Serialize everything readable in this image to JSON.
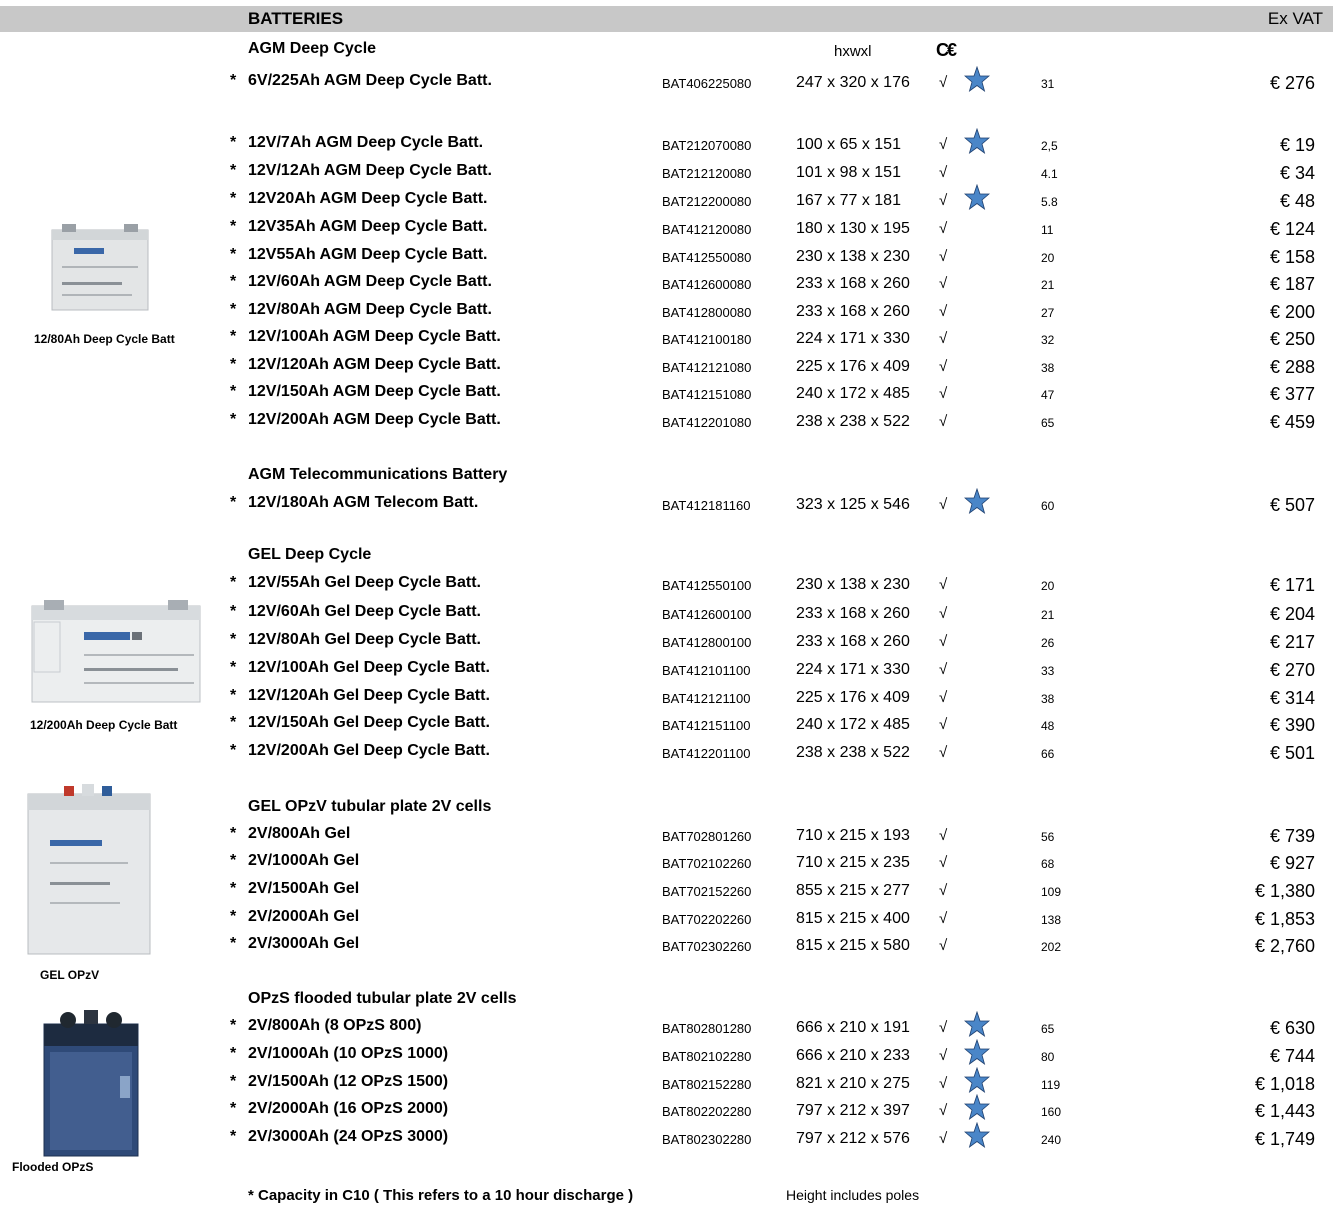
{
  "header": {
    "title": "BATTERIES",
    "exvat": "Ex VAT"
  },
  "columns": {
    "dims_label": "hxwxl",
    "ce_mark": "C€"
  },
  "sections": [
    {
      "title": "AGM Deep Cycle",
      "rows": [
        {
          "name": "6V/225Ah AGM Deep Cycle Batt.",
          "code": "BAT406225080",
          "dims": "247 x 320 x 176",
          "weight": "31",
          "price": "€ 276",
          "starred": true
        }
      ]
    },
    {
      "title": "",
      "rows": [
        {
          "name": "12V/7Ah AGM Deep Cycle Batt.",
          "code": "BAT212070080",
          "dims": "100 x 65 x 151",
          "weight": "2,5",
          "price": "€ 19",
          "starred": true
        },
        {
          "name": "12V/12Ah AGM Deep Cycle Batt.",
          "code": "BAT212120080",
          "dims": "101 x 98 x 151",
          "weight": "4.1",
          "price": "€ 34",
          "starred": false
        },
        {
          "name": "12V20Ah AGM Deep Cycle Batt.",
          "code": "BAT212200080",
          "dims": "167 x 77 x 181",
          "weight": "5.8",
          "price": "€ 48",
          "starred": true
        },
        {
          "name": "12V35Ah AGM Deep Cycle Batt.",
          "code": "BAT412120080",
          "dims": "180 x 130 x 195",
          "weight": "11",
          "price": "€ 124",
          "starred": false
        },
        {
          "name": "12V55Ah AGM Deep Cycle Batt.",
          "code": "BAT412550080",
          "dims": "230 x 138 x 230",
          "weight": "20",
          "price": "€ 158",
          "starred": false
        },
        {
          "name": "12V/60Ah AGM Deep Cycle Batt.",
          "code": "BAT412600080",
          "dims": "233 x 168 x 260",
          "weight": "21",
          "price": "€ 187",
          "starred": false
        },
        {
          "name": "12V/80Ah AGM Deep Cycle Batt.",
          "code": "BAT412800080",
          "dims": "233 x 168 x 260",
          "weight": "27",
          "price": "€ 200",
          "starred": false
        },
        {
          "name": "12V/100Ah AGM Deep Cycle Batt.",
          "code": "BAT412100180",
          "dims": "224 x 171 x 330",
          "weight": "32",
          "price": "€ 250",
          "starred": false
        },
        {
          "name": "12V/120Ah AGM Deep Cycle Batt.",
          "code": "BAT412121080",
          "dims": "225 x 176 x 409",
          "weight": "38",
          "price": "€ 288",
          "starred": false
        },
        {
          "name": "12V/150Ah AGM Deep Cycle Batt.",
          "code": "BAT412151080",
          "dims": "240 x 172 x 485",
          "weight": "47",
          "price": "€ 377",
          "starred": false
        },
        {
          "name": "12V/200Ah AGM Deep Cycle Batt.",
          "code": "BAT412201080",
          "dims": "238 x 238 x 522",
          "weight": "65",
          "price": "€ 459",
          "starred": false
        }
      ]
    },
    {
      "title": "AGM Telecommunications Battery",
      "rows": [
        {
          "name": "12V/180Ah AGM Telecom Batt.",
          "code": "BAT412181160",
          "dims": "323 x 125 x 546",
          "weight": "60",
          "price": "€ 507",
          "starred": true
        }
      ]
    },
    {
      "title": "GEL Deep Cycle",
      "rows": [
        {
          "name": "12V/55Ah Gel Deep Cycle Batt.",
          "code": "BAT412550100",
          "dims": "230 x 138 x 230",
          "weight": "20",
          "price": "€ 171",
          "starred": false
        },
        {
          "name": "12V/60Ah Gel Deep Cycle Batt.",
          "code": "BAT412600100",
          "dims": "233 x 168 x 260",
          "weight": "21",
          "price": "€ 204",
          "starred": false
        },
        {
          "name": "12V/80Ah Gel Deep Cycle Batt.",
          "code": "BAT412800100",
          "dims": "233 x 168 x 260",
          "weight": "26",
          "price": "€ 217",
          "starred": false
        },
        {
          "name": "12V/100Ah Gel Deep Cycle Batt.",
          "code": "BAT412101100",
          "dims": "224 x 171 x 330",
          "weight": "33",
          "price": "€ 270",
          "starred": false
        },
        {
          "name": "12V/120Ah Gel Deep Cycle Batt.",
          "code": "BAT412121100",
          "dims": "225 x 176 x 409",
          "weight": "38",
          "price": "€ 314",
          "starred": false
        },
        {
          "name": "12V/150Ah Gel Deep Cycle Batt.",
          "code": "BAT412151100",
          "dims": "240 x 172 x 485",
          "weight": "48",
          "price": "€ 390",
          "starred": false
        },
        {
          "name": "12V/200Ah Gel Deep Cycle Batt.",
          "code": "BAT412201100",
          "dims": "238 x 238 x 522",
          "weight": "66",
          "price": "€ 501",
          "starred": false
        }
      ]
    },
    {
      "title": "GEL OPzV tubular plate 2V cells",
      "rows": [
        {
          "name": "2V/800Ah Gel",
          "code": "BAT702801260",
          "dims": "710 x 215 x 193",
          "weight": "56",
          "price": "€ 739",
          "starred": false
        },
        {
          "name": "2V/1000Ah Gel",
          "code": "BAT702102260",
          "dims": "710 x 215 x 235",
          "weight": "68",
          "price": "€ 927",
          "starred": false
        },
        {
          "name": "2V/1500Ah Gel",
          "code": "BAT702152260",
          "dims": "855 x 215 x 277",
          "weight": "109",
          "price": "€ 1,380",
          "starred": false
        },
        {
          "name": "2V/2000Ah Gel",
          "code": "BAT702202260",
          "dims": "815 x 215 x 400",
          "weight": "138",
          "price": "€ 1,853",
          "starred": false
        },
        {
          "name": "2V/3000Ah Gel",
          "code": "BAT702302260",
          "dims": "815 x 215 x 580",
          "weight": "202",
          "price": "€ 2,760",
          "starred": false
        }
      ]
    },
    {
      "title": "OPzS flooded tubular plate 2V cells",
      "rows": [
        {
          "name": "2V/800Ah (8 OPzS 800)",
          "code": "BAT802801280",
          "dims": "666 x 210 x 191",
          "weight": "65",
          "price": "€ 630",
          "starred": true
        },
        {
          "name": "2V/1000Ah (10 OPzS 1000)",
          "code": "BAT802102280",
          "dims": "666 x 210 x 233",
          "weight": "80",
          "price": "€ 744",
          "starred": true
        },
        {
          "name": "2V/1500Ah (12 OPzS 1500)",
          "code": "BAT802152280",
          "dims": "821 x 210 x 275",
          "weight": "119",
          "price": "€ 1,018",
          "starred": true
        },
        {
          "name": "2V/2000Ah (16 OPzS 2000)",
          "code": "BAT802202280",
          "dims": "797 x 212 x 397",
          "weight": "160",
          "price": "€ 1,443",
          "starred": true
        },
        {
          "name": "2V/3000Ah (24 OPzS 3000)",
          "code": "BAT802302280",
          "dims": "797 x 212 x 576",
          "weight": "240",
          "price": "€ 1,749",
          "starred": true
        }
      ]
    }
  ],
  "row_marker": "*",
  "check_mark": "√",
  "star_color": "#4a86c8",
  "captions": {
    "agm_photo": "12/80Ah Deep Cycle Batt",
    "gel_photo": "12/200Ah Deep Cycle Batt",
    "opzv_photo": "GEL OPzV",
    "opzs_photo": "Flooded OPzS"
  },
  "footer": {
    "capacity_note": "* Capacity in C10  ( This refers to a 10 hour discharge )",
    "height_note": "Height includes poles"
  }
}
